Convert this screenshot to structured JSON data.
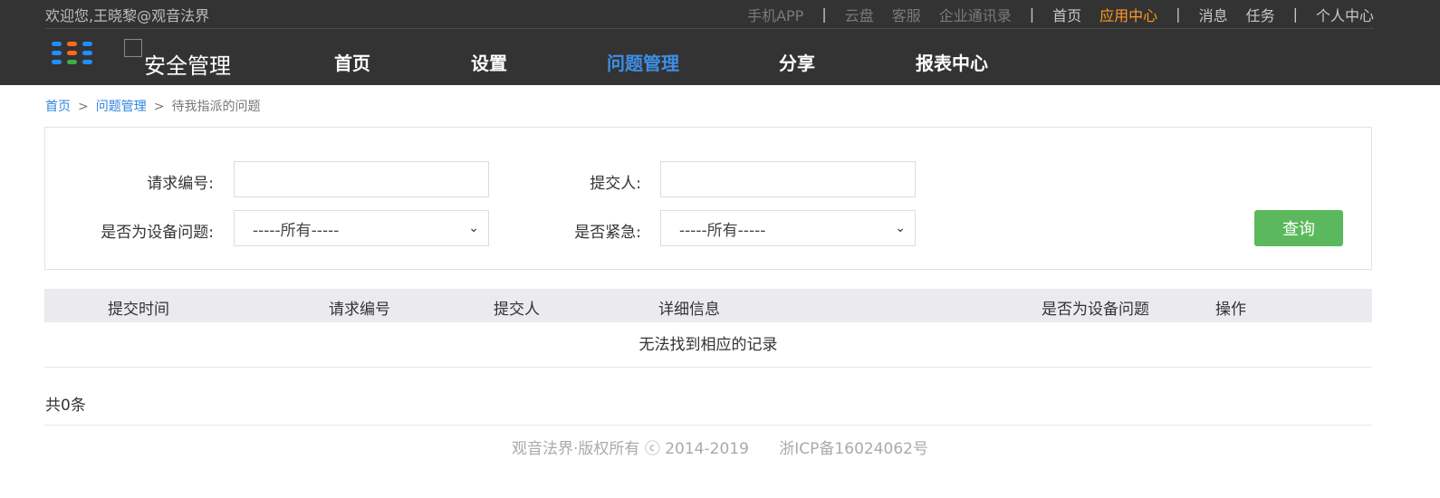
{
  "topbar": {
    "welcome": "欢迎您,王晓黎@观音法界",
    "links": {
      "mobile_app": "手机APP",
      "cloud_disk": "云盘",
      "customer_service": "客服",
      "contacts": "企业通讯录",
      "home": "首页",
      "app_center": "应用中心",
      "messages": "消息",
      "tasks": "任务",
      "personal_center": "个人中心"
    },
    "separator": "|"
  },
  "brand": {
    "title": "安全管理"
  },
  "nav": {
    "home": "首页",
    "settings": "设置",
    "issue_management": "问题管理",
    "share": "分享",
    "report_center": "报表中心"
  },
  "breadcrumb": {
    "home": "首页",
    "issue_management": "问题管理",
    "current": "待我指派的问题",
    "separator": ">"
  },
  "search": {
    "request_no_label": "请求编号:",
    "request_no_value": "",
    "submitter_label": "提交人:",
    "submitter_value": "",
    "is_device_label": "是否为设备问题:",
    "is_device_selected": "-----所有-----",
    "is_urgent_label": "是否紧急:",
    "is_urgent_selected": "-----所有-----",
    "query_button": "查询"
  },
  "table": {
    "columns": [
      "提交时间",
      "请求编号",
      "提交人",
      "详细信息",
      "是否为设备问题",
      "操作"
    ],
    "empty_text": "无法找到相应的记录"
  },
  "summary": {
    "total": "共0条"
  },
  "footer": {
    "copyright": "观音法界·版权所有 ⓒ 2014-2019",
    "icp": "浙ICP备16024062号"
  },
  "colors": {
    "header_bg": "#333333",
    "active_nav": "#3d8fe8",
    "app_center_accent": "#ff9a1f",
    "link_blue": "#2f86de",
    "query_button_green": "#5cb85c"
  }
}
